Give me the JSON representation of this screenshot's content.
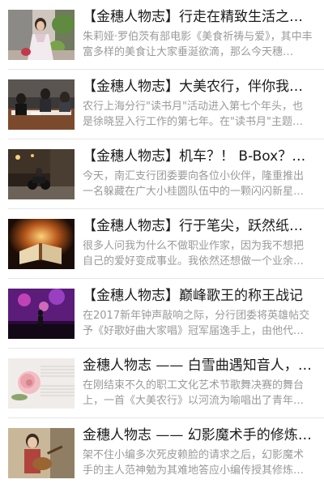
{
  "articles": [
    {
      "title": "【金穗人物志】行走在精致生活之上…",
      "summary": "朱莉娅·罗伯茨有部电影《美食祈祷与爱》，其中丰富多样的美食让大家垂涎欲滴，那么今天穗…",
      "thumbnail": "photo-woman-dress-plants"
    },
    {
      "title": "【金穗人物志】大美农行，伴你我成…",
      "summary": "农行上海分行\"读书月\"活动进入第七个年头，也是徐晓昱入行工作的第七年。在\"读书月\"主题演…",
      "thumbnail": "photo-meeting-table"
    },
    {
      "title": "【金穗人物志】机车？！ B-Box？！ 南…",
      "summary": "今天，南汇支行团委要向各位小伙伴，隆重推出一名躲藏在广大小桂圆队伍中的一颗闪闪新星…",
      "thumbnail": "photo-motorcycle-night"
    },
    {
      "title": "【金穗人物志】行于笔尖，跃然纸上…",
      "summary": "很多人问我为什么不做职业作家，因为我不想把自己的爱好变成事业。我依然还想做一个业余…",
      "thumbnail": "photo-open-book-glow"
    },
    {
      "title": "【金穗人物志】巅峰歌王的称王战记",
      "summary": "在2017新年钟声敲响之际，分行团委将英雄帖交予《好歌好曲大家唱》冠军届逸手上，由他代…",
      "thumbnail": "photo-stage-singer"
    },
    {
      "title": "金穗人物志 —— 白雪曲遇知音人，琴…",
      "summary": "在刚结束不久的职工文化艺术节歌舞决赛的舞台上，一首《大美农行》以河流为喻唱出了青年…",
      "thumbnail": "photo-rose-sheet-music"
    },
    {
      "title": "金穗人物志 —— 幻影魔术手的修炼秘籍",
      "summary": "架不住小编多次死皮赖脸的请求之后，幻影魔术手的主人范神勉为其难地答应小编传授其修炼…",
      "thumbnail": "photo-woman-guitar"
    }
  ]
}
